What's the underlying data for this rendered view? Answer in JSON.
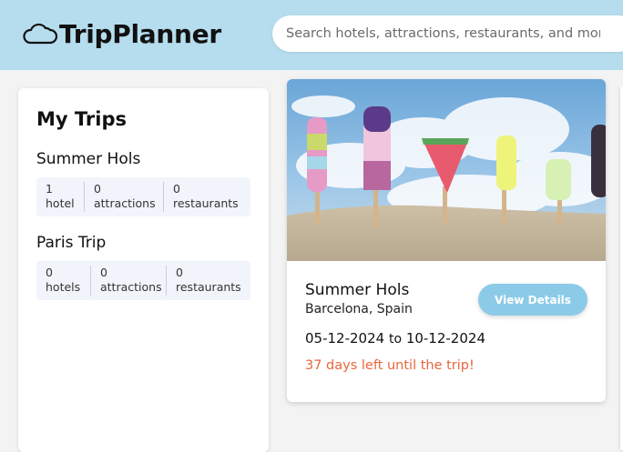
{
  "app": {
    "name": "TripPlanner",
    "logo_icon": "cloud-icon"
  },
  "search": {
    "placeholder": "Search hotels, attractions, restaurants, and more...",
    "value": ""
  },
  "sidebar": {
    "title": "My Trips",
    "trips": [
      {
        "name": "Summer Hols",
        "stats": [
          {
            "count": "1",
            "label": "hotel"
          },
          {
            "count": "0",
            "label": "attractions"
          },
          {
            "count": "0",
            "label": "restaurants"
          }
        ]
      },
      {
        "name": "Paris Trip",
        "stats": [
          {
            "count": "0",
            "label": "hotels"
          },
          {
            "count": "0",
            "label": "attractions"
          },
          {
            "count": "0",
            "label": "restaurants"
          }
        ]
      }
    ]
  },
  "trip_card": {
    "image": "ice-lollies-on-sand-photo",
    "name": "Summer Hols",
    "location": "Barcelona, Spain",
    "start_date": "05-12-2024",
    "date_separator": "to",
    "end_date": "10-12-2024",
    "countdown": "37 days left until the trip!",
    "button_label": "View Details"
  },
  "colors": {
    "header_bg": "#b5ddee",
    "accent_button": "#8ccbe8",
    "countdown_text": "#e8663d",
    "stats_bg": "#f1f5fb"
  }
}
